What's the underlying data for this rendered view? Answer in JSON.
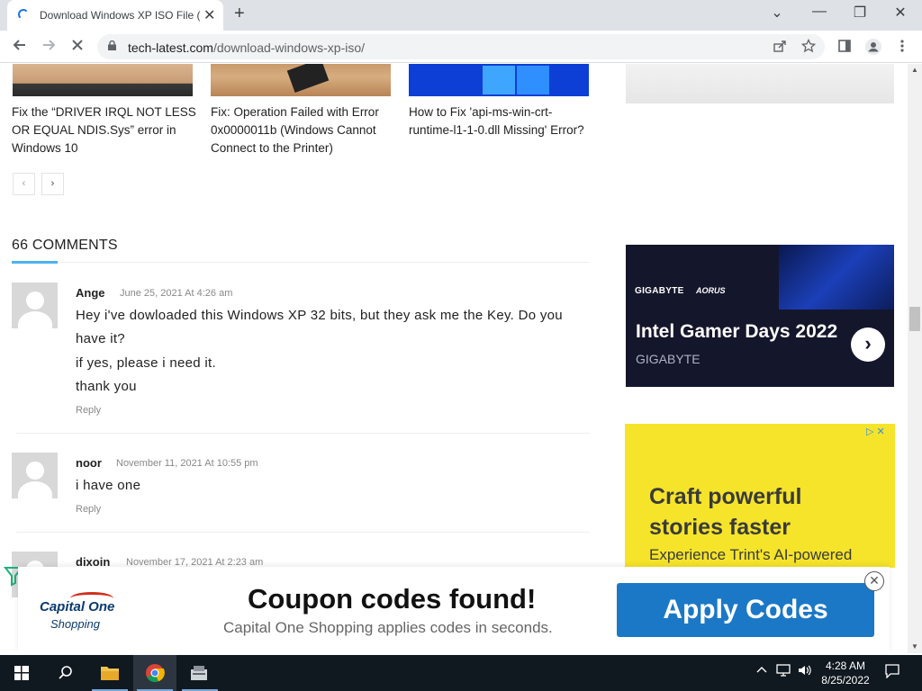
{
  "browser": {
    "tab_title": "Download Windows XP ISO File (",
    "tab_close": "✕",
    "new_tab": "+",
    "win_minimize": "—",
    "win_restore": "❐",
    "win_close": "✕",
    "win_dropdown": "⌄",
    "url_domain": "tech-latest.com",
    "url_path": "/download-windows-xp-iso/",
    "icons": [
      "back-icon",
      "forward-icon",
      "stop-icon",
      "lock-icon",
      "share-icon",
      "star-icon",
      "sidepanel-icon",
      "profile-icon",
      "menu-icon"
    ]
  },
  "related_posts": [
    {
      "title": "Fix the “DRIVER IRQL NOT LESS OR EQUAL NDIS.Sys” error in Windows 10"
    },
    {
      "title": "Fix: Operation Failed with Error 0x0000011b (Windows Cannot Connect to the Printer)"
    },
    {
      "title": "How to Fix 'api-ms-win-crt-runtime-l1-1-0.dll Missing' Error?"
    }
  ],
  "pagination": {
    "prev": "‹",
    "next": "›"
  },
  "comments": {
    "heading": "66 COMMENTS",
    "reply_label": "Reply",
    "items": [
      {
        "author": "Ange",
        "date": "June 25, 2021 At 4:26 am",
        "lines": [
          "Hey i've dowloaded this Windows XP 32 bits, but they ask me the Key. Do you have it?",
          "if yes, please i need it.",
          "thank you"
        ]
      },
      {
        "author": "noor",
        "date": "November 11, 2021 At 10:55 pm",
        "lines": [
          "i have one"
        ]
      },
      {
        "author": "dixoin",
        "date": "November 17, 2021 At 2:23 am",
        "lines": []
      }
    ]
  },
  "sidebar": {
    "gigabyte_ad": {
      "brand": "GIGABYTE",
      "brand2": "AORUS",
      "headline": "Intel Gamer Days 2022",
      "sub": "GIGABYTE",
      "arrow": "›"
    },
    "trint_ad": {
      "adchoices": "▷ ✕",
      "headline_1": "Craft powerful",
      "headline_2": "stories faster",
      "sub": "Experience Trint's AI-powered"
    }
  },
  "coupon_ad": {
    "logo_1": "Capital One",
    "logo_2": "Shopping",
    "title": "Coupon codes found!",
    "subtitle": "Capital One Shopping applies codes in seconds.",
    "button": "Apply Codes",
    "close": "✕"
  },
  "taskbar": {
    "time": "4:28 AM",
    "date": "8/25/2022",
    "apps": [
      "start-icon",
      "search-icon",
      "file-explorer-icon",
      "chrome-icon",
      "app-icon"
    ],
    "tray": [
      "chevron-up-icon",
      "network-icon",
      "volume-icon",
      "notification-icon"
    ]
  }
}
